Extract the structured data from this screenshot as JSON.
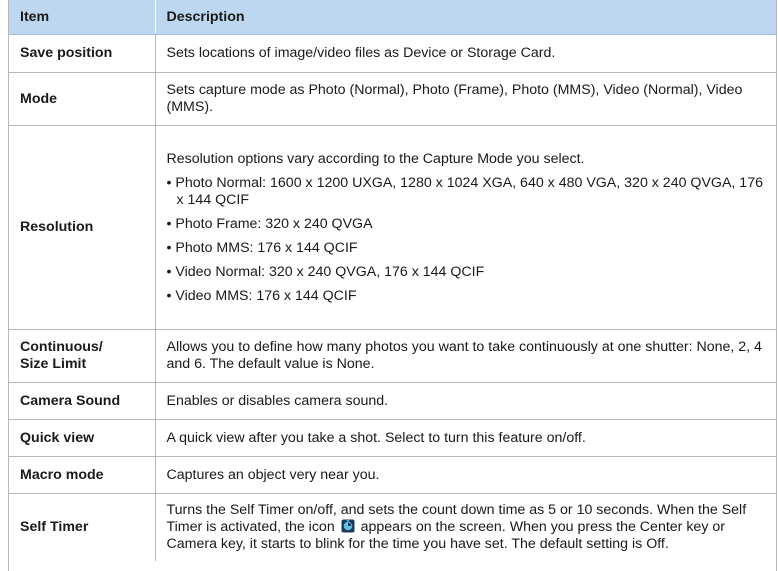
{
  "table": {
    "header": {
      "item": "Item",
      "description": "Description"
    },
    "rows": [
      {
        "item": "Save position",
        "description": "Sets locations of image/video files as Device or Storage Card."
      },
      {
        "item": "Mode",
        "description": "Sets capture mode as Photo (Normal), Photo (Frame), Photo (MMS), Video (Normal), Video (MMS)."
      },
      {
        "item": "Resolution",
        "intro": "Resolution options vary according to the Capture Mode you select.",
        "bullets": [
          "• Photo Normal: 1600 x 1200 UXGA, 1280 x 1024 XGA, 640 x 480 VGA, 320 x 240 QVGA, 176 x 144 QCIF",
          "• Photo Frame: 320 x 240 QVGA",
          "• Photo MMS: 176 x 144 QCIF",
          "• Video Normal: 320 x 240 QVGA, 176 x 144 QCIF",
          "• Video MMS: 176 x 144 QCIF"
        ]
      },
      {
        "item_line1": "Continuous/",
        "item_line2": "Size Limit",
        "description": "Allows you to define how many photos you want to take continuously at one shutter: None, 2, 4 and 6. The default value is None."
      },
      {
        "item": "Camera Sound",
        "description": "Enables or disables camera sound."
      },
      {
        "item": "Quick view",
        "description": "A quick view after you take a shot. Select to turn this feature on/off."
      },
      {
        "item": "Macro mode",
        "description": "Captures an object very near you."
      },
      {
        "item": "Self Timer",
        "description_before_icon": "Turns the Self Timer on/off, and sets the count down time as 5 or 10 seconds. When the Self Timer is activated, the icon",
        "icon": "self-timer-icon",
        "description_after_icon": "appears on the screen. When you press the Center key or Camera key, it starts to blink for the time you have set. The default setting is Off."
      }
    ]
  },
  "colors": {
    "header_bg": "#bdd7f0",
    "border": "#b8b8b8",
    "text": "#1a1a1a"
  }
}
